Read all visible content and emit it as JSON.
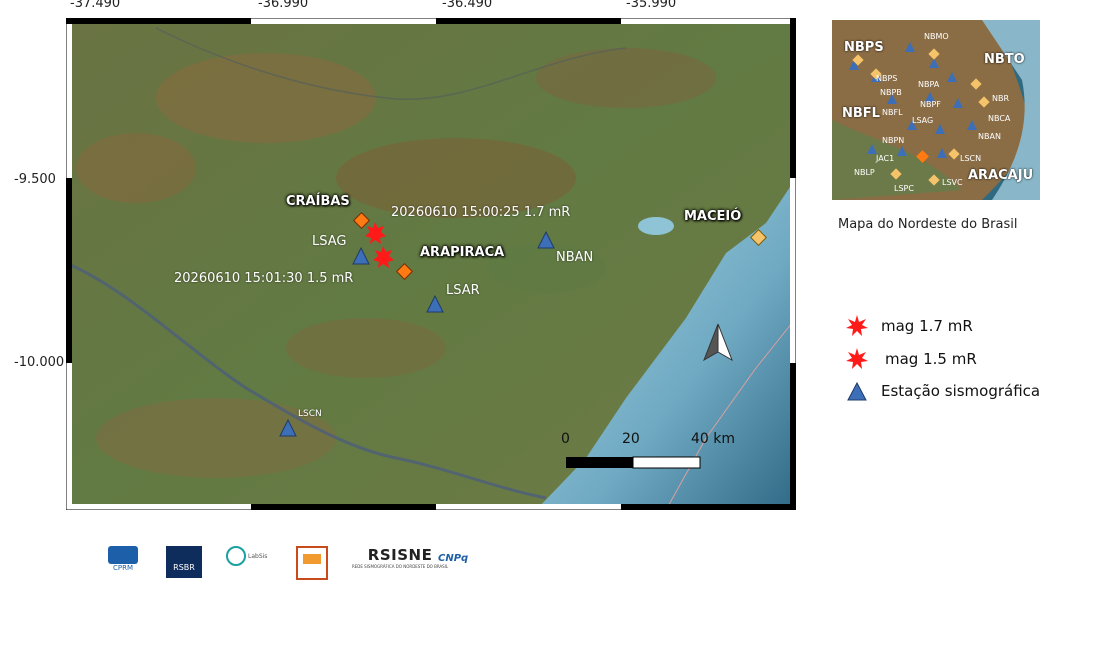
{
  "map": {
    "lon_ticks": [
      "-37.490",
      "-36.990",
      "-36.490",
      "-35.990"
    ],
    "lat_ticks": [
      "-9.500",
      "-10.000"
    ],
    "cities": {
      "craibas": "CRAÍBAS",
      "arapiraca": "ARAPIRACA",
      "maceio": "MACEIÓ"
    },
    "stations": {
      "lsag": "LSAG",
      "lsar": "LSAR",
      "nban": "NBAN",
      "lscn": "LSCN"
    },
    "events": [
      {
        "label": "20260610 15:00:25 1.7 mR",
        "magnitude": "1.7 mR"
      },
      {
        "label": "20260610 15:01:30 1.5 mR",
        "magnitude": "1.5 mR"
      }
    ],
    "scale_bar": {
      "labels": [
        "0",
        "20",
        "40 km"
      ]
    },
    "north_arrow": "north-arrow-icon"
  },
  "inset": {
    "caption": "Mapa do Nordeste do Brasil",
    "big_labels": [
      "NBPS",
      "NBTO",
      "NBFL",
      "ARACAJU"
    ],
    "small_labels": [
      "NBMO",
      "NBPS",
      "NBPB",
      "NBPA",
      "NBFL",
      "NBPF",
      "LSAG",
      "NBPN",
      "JAC1",
      "NBLP",
      "LSPC",
      "LSVC",
      "LSCN",
      "NBAN",
      "NBR",
      "NBCA"
    ]
  },
  "legend": {
    "items": [
      {
        "label": "mag 1.7 mR",
        "icon": "red-star-icon"
      },
      {
        "label": "mag 1.5 mR",
        "icon": "red-star-icon"
      },
      {
        "label": "Estação sismográfica",
        "icon": "blue-triangle-icon"
      }
    ]
  },
  "logos": {
    "cprm": "CPRM",
    "rsbr": "RSBR",
    "labsis": "LabSis",
    "unb": "",
    "rsisne": "RSISNE",
    "rsisne_sub": "REDE SISMOGRÁFICA DO NORDESTE DO BRASIL",
    "cnpq": "CNPq"
  },
  "colors": {
    "land": "#5f6e3e",
    "sea": "#8fc4d6",
    "deep_sea": "#3f7f9c",
    "event_star": "#ff1a1a",
    "city_marker": "#ff7a10",
    "station": "#3d6fb8",
    "border_alt": "#000000"
  }
}
